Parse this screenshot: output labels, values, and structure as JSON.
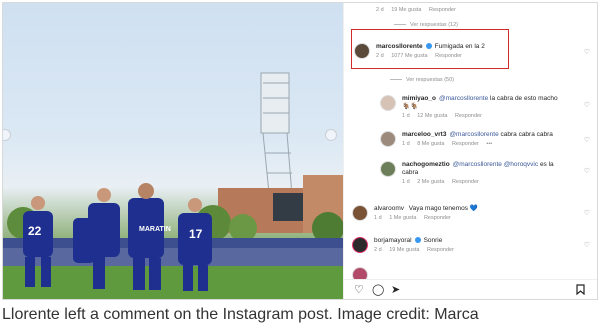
{
  "top_meta": {
    "age": "2 d",
    "likes": "19 Me gusta",
    "reply": "Responder",
    "more": "Ver respuestas (12)"
  },
  "highlighted_comment": {
    "username": "marcosllorente",
    "text": "Fumigada en la 2",
    "age": "2 d",
    "likes": "1077 Me gusta",
    "reply": "Responder"
  },
  "view_replies": "Ver respuestas (50)",
  "replies": [
    {
      "username": "mimiyao_o",
      "mention": "@marcosllorente",
      "text": "la cabra de esto macho",
      "emoji": "🐐🐐",
      "age": "1 d",
      "likes": "12 Me gusta",
      "reply": "Responder"
    },
    {
      "username": "marceloo_vrt3",
      "mention": "@marcosllorente",
      "text": "cabra cabra cabra",
      "emoji": "",
      "age": "1 d",
      "likes": "8 Me gusta",
      "reply": "Responder"
    },
    {
      "username": "nachogomeztio",
      "mention": "@marcosllorente @horoqvvic",
      "text": "es la cabra",
      "emoji": "",
      "age": "1 d",
      "likes": "2 Me gusta",
      "reply": "Responder"
    }
  ],
  "comments": [
    {
      "username": "alvaroomv",
      "text": "Vaya mago tenemos",
      "emoji": "💙",
      "age": "1 d",
      "likes": "1 Me gusta",
      "reply": "Responder"
    },
    {
      "username": "borjamayoral",
      "text": "Sonrie",
      "emoji": "",
      "age": "2 d",
      "likes": "19 Me gusta",
      "reply": "Responder"
    }
  ],
  "actions": {
    "like": "♡",
    "comment": "◯",
    "share": "➤",
    "save": "🔖"
  },
  "caption": "Llorente left a comment on the Instagram post. Image credit: Marca"
}
